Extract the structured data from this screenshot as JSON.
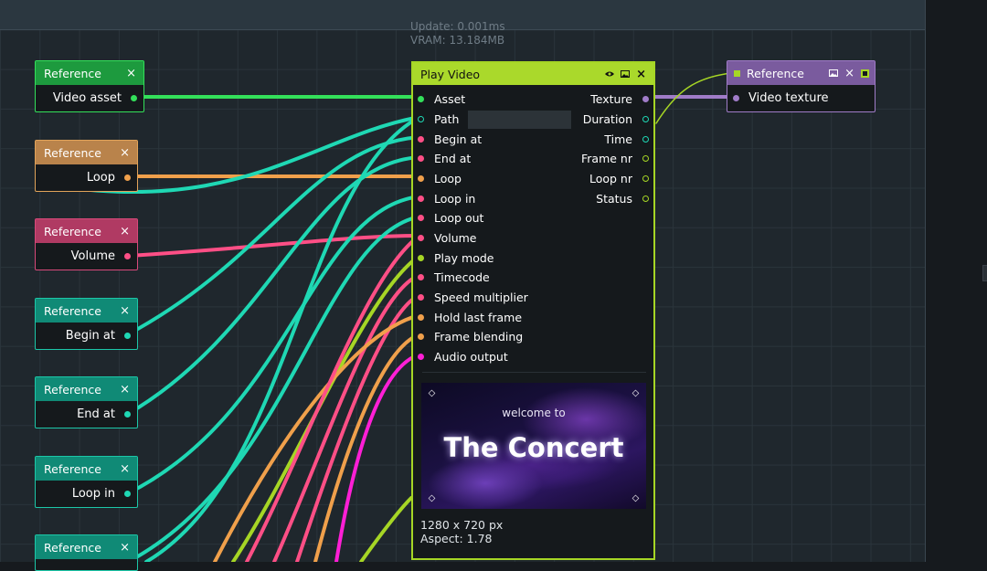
{
  "stats": {
    "update": "Update: 0.001ms",
    "vram": "VRAM: 13.184MB"
  },
  "reference_nodes": [
    {
      "title": "Reference",
      "close": "×",
      "output": "Video asset",
      "color": "#33e05a"
    },
    {
      "title": "Reference",
      "close": "×",
      "output": "Loop",
      "color": "#f0a04b"
    },
    {
      "title": "Reference",
      "close": "×",
      "output": "Volume",
      "color": "#ff4f86"
    },
    {
      "title": "Reference",
      "close": "×",
      "output": "Begin at",
      "color": "#1fd8b4"
    },
    {
      "title": "Reference",
      "close": "×",
      "output": "End at",
      "color": "#1fd8b4"
    },
    {
      "title": "Reference",
      "close": "×",
      "output": "Loop in",
      "color": "#1fd8b4"
    },
    {
      "title": "Reference",
      "close": "×",
      "output": "",
      "color": "#1fd8b4"
    }
  ],
  "play_video": {
    "title": "Play Video",
    "icons": [
      "eye-icon",
      "image-icon",
      "close-icon"
    ],
    "close": "×",
    "inputs": [
      {
        "label": "Asset",
        "color": "#33e05a",
        "hollow": false
      },
      {
        "label": "Path",
        "color": "#1fd8b4",
        "hollow": true
      },
      {
        "label": "Begin at",
        "color": "#ff4f86",
        "hollow": false
      },
      {
        "label": "End at",
        "color": "#ff4f86",
        "hollow": false
      },
      {
        "label": "Loop",
        "color": "#f0a04b",
        "hollow": false
      },
      {
        "label": "Loop in",
        "color": "#ff4f86",
        "hollow": false
      },
      {
        "label": "Loop out",
        "color": "#ff4f86",
        "hollow": false
      },
      {
        "label": "Volume",
        "color": "#ff4f86",
        "hollow": false
      },
      {
        "label": "Play mode",
        "color": "#a6d625",
        "hollow": false
      },
      {
        "label": "Timecode",
        "color": "#ff4f86",
        "hollow": false
      },
      {
        "label": "Speed multiplier",
        "color": "#ff4f86",
        "hollow": false
      },
      {
        "label": "Hold last frame",
        "color": "#f0a04b",
        "hollow": false
      },
      {
        "label": "Frame blending",
        "color": "#f0a04b",
        "hollow": false
      },
      {
        "label": "Audio output",
        "color": "#ff1fd6",
        "hollow": false
      }
    ],
    "path_value": "",
    "outputs": [
      {
        "label": "Texture",
        "color": "#a07cc8",
        "hollow": false
      },
      {
        "label": "Duration",
        "color": "#1fd8b4",
        "hollow": true
      },
      {
        "label": "Time",
        "color": "#1fd8b4",
        "hollow": true
      },
      {
        "label": "Frame nr",
        "color": "#a6d625",
        "hollow": true
      },
      {
        "label": "Loop nr",
        "color": "#a6d625",
        "hollow": true
      },
      {
        "label": "Status",
        "color": "#a6d625",
        "hollow": true
      }
    ],
    "preview": {
      "small_text": "welcome to",
      "big_text": "The Concert"
    },
    "resolution": "1280 x 720 px",
    "aspect": "Aspect: 1.78"
  },
  "video_texture_ref": {
    "title": "Reference",
    "icons": [
      "image-icon",
      "close-icon",
      "pin-icon"
    ],
    "close": "×",
    "input": "Video texture",
    "color": "#a07cc8"
  }
}
